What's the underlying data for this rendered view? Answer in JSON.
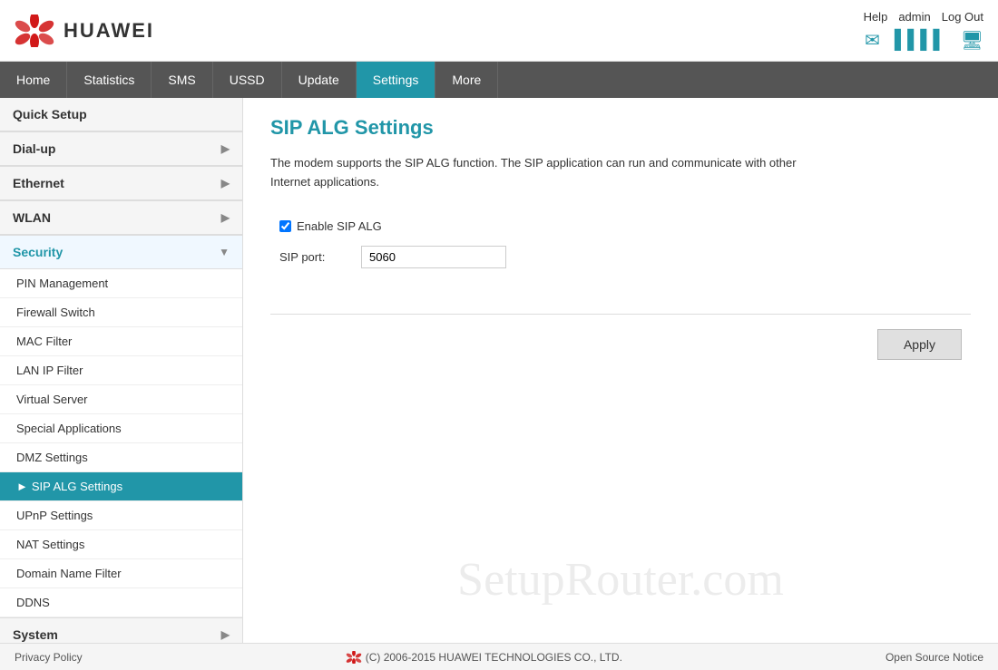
{
  "header": {
    "logo_text": "HUAWEI",
    "user_help": "Help",
    "user_admin": "admin",
    "user_logout": "Log Out"
  },
  "nav": {
    "items": [
      {
        "label": "Home",
        "active": false
      },
      {
        "label": "Statistics",
        "active": false
      },
      {
        "label": "SMS",
        "active": false
      },
      {
        "label": "USSD",
        "active": false
      },
      {
        "label": "Update",
        "active": false
      },
      {
        "label": "Settings",
        "active": true
      },
      {
        "label": "More",
        "active": false
      }
    ]
  },
  "sidebar": {
    "sections": [
      {
        "label": "Quick Setup",
        "expanded": false,
        "has_arrow": false,
        "items": []
      },
      {
        "label": "Dial-up",
        "expanded": false,
        "has_arrow": true,
        "items": []
      },
      {
        "label": "Ethernet",
        "expanded": false,
        "has_arrow": true,
        "items": []
      },
      {
        "label": "WLAN",
        "expanded": false,
        "has_arrow": true,
        "items": []
      },
      {
        "label": "Security",
        "expanded": true,
        "has_arrow": true,
        "active": true,
        "items": [
          {
            "label": "PIN Management",
            "active": false
          },
          {
            "label": "Firewall Switch",
            "active": false
          },
          {
            "label": "MAC Filter",
            "active": false
          },
          {
            "label": "LAN IP Filter",
            "active": false
          },
          {
            "label": "Virtual Server",
            "active": false
          },
          {
            "label": "Special Applications",
            "active": false
          },
          {
            "label": "DMZ Settings",
            "active": false
          },
          {
            "label": "SIP ALG Settings",
            "active": true
          },
          {
            "label": "UPnP Settings",
            "active": false
          },
          {
            "label": "NAT Settings",
            "active": false
          },
          {
            "label": "Domain Name Filter",
            "active": false
          },
          {
            "label": "DDNS",
            "active": false
          }
        ]
      },
      {
        "label": "System",
        "expanded": false,
        "has_arrow": true,
        "items": []
      }
    ]
  },
  "main": {
    "page_title": "SIP ALG Settings",
    "description_line1": "The modem supports the SIP ALG function. The SIP application can run and communicate with other",
    "description_line2": "Internet applications.",
    "enable_label": "Enable SIP ALG",
    "sip_port_label": "SIP port:",
    "sip_port_value": "5060",
    "apply_button": "Apply"
  },
  "footer": {
    "privacy_policy": "Privacy Policy",
    "copyright": "(C) 2006-2015 HUAWEI TECHNOLOGIES CO., LTD.",
    "open_source": "Open Source Notice"
  },
  "watermark": "SetupRouter.com"
}
